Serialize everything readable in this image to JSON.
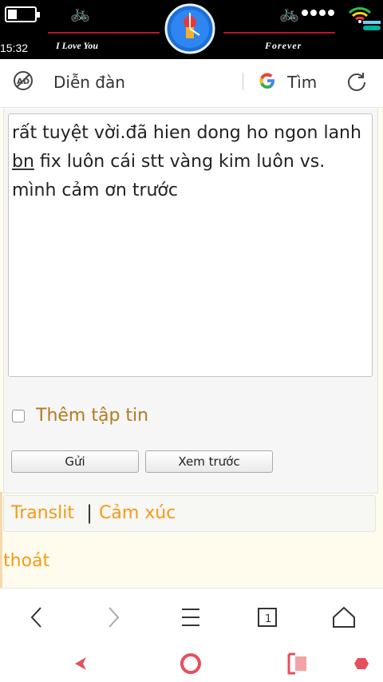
{
  "status": {
    "time": "15:32",
    "left_text": "I Love You",
    "right_text": "Forever",
    "battery_level": 0.35
  },
  "addressbar": {
    "site": "Diễn đàn",
    "search_label": "Tìm"
  },
  "form": {
    "message_text": "rất tuyệt vời.đã hien dong ho ngon lanh ",
    "message_underlined": "bn",
    "message_text_after": " fix luôn cái stt vàng kim luôn vs. mình cảm ơn trước",
    "attach_label": "Thêm tập tin",
    "attach_checked": false,
    "send_label": "Gửi",
    "preview_label": "Xem trước"
  },
  "links": {
    "translit": "Translit",
    "separator": "|",
    "emoji": "Cảm xúc",
    "logout": "thoát"
  },
  "colors": {
    "link_orange": "#f39a1a",
    "attach_brown": "#b7791f",
    "nav_red": "#e5505e"
  }
}
